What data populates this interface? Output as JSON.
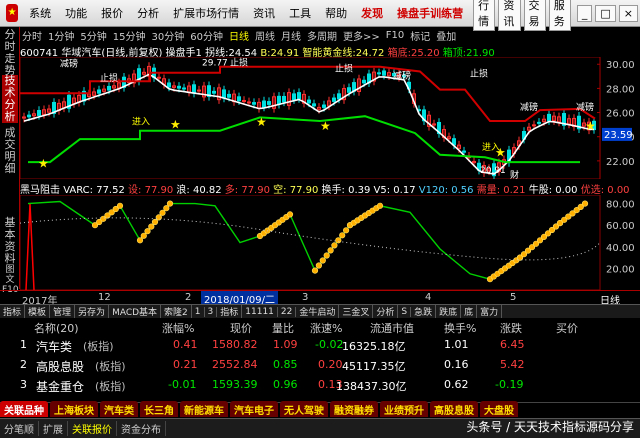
{
  "menu": {
    "app": "系统",
    "items": [
      "功能",
      "报价",
      "分析",
      "扩展市场行情",
      "资讯",
      "工具",
      "帮助"
    ],
    "highlight": "发现",
    "promo": "操盘手训练营",
    "right_btns": [
      "行情",
      "资讯",
      "交易",
      "服务"
    ]
  },
  "left_tabs": [
    "分时走势",
    "技术分析",
    "成交明细",
    "基本资料",
    "图文F10"
  ],
  "periods": [
    "分时",
    "1分钟",
    "5分钟",
    "15分钟",
    "30分钟",
    "60分钟",
    "日线",
    "周线",
    "月线",
    "多周期",
    "更多>>",
    "F10",
    "标记",
    "叠加"
  ],
  "active_period": "日线",
  "info": {
    "code": "600741",
    "name": "华域汽车(日线,前复权)",
    "f1_label": "操盘手1",
    "f1": "拐线:",
    "f1v": "24.54",
    "b_label": "B:",
    "b_val": "24.91",
    "zn_label": "智能黄金线:",
    "zn_val": "24.72",
    "box_hi": "箱底:",
    "box_hi_v": "25.20",
    "box_lo": "箱顶:",
    "box_lo_v": "21.90"
  },
  "price_axis": [
    "30.00",
    "28.00",
    "26.00",
    "24.00",
    "22.00"
  ],
  "price_tag": "23.59",
  "annot": {
    "stop1": "止损",
    "stop2": "止损",
    "stop3": "止损",
    "stop4": "止损",
    "jian1": "减磅",
    "jian2": "减磅",
    "jian3": "减磅",
    "jian4": "减磅",
    "jin1": "进入",
    "jin2": "进入",
    "hi": "29.77",
    "lo": "20.91",
    "cai": "财"
  },
  "ind": {
    "name": "黑马阻击",
    "varc": "VARC: 77.52",
    "a": "设: 77.90",
    "b": "浪: 40.82",
    "c": "多: 77.90",
    "d": "空: 77.90",
    "e": "换手: 0.39",
    "f": "V5: 0.17",
    "g": "V120: 0.56",
    "h": "需量: 0.21",
    "i": "牛股: 0.00",
    "j": "优选: 0.00"
  },
  "ind_axis": [
    "80.00",
    "60.00",
    "40.00",
    "20.00"
  ],
  "time_axis": [
    "2017年",
    "12",
    "2",
    "3",
    "4",
    "5"
  ],
  "time_sel": "2018/01/09/二",
  "timebar_right": "日线",
  "tools": [
    "指标",
    "模板",
    "管理",
    "另存为",
    "MACD基本",
    "索隆2",
    "1",
    "3",
    "指标",
    "11111",
    "22",
    "金牛启动",
    "三金叉",
    "分析",
    "S",
    "急跌",
    "跌底",
    "底",
    "富力"
  ],
  "table": {
    "headers": [
      "名称(20)",
      "涨幅%",
      "现价",
      "量比",
      "涨速%",
      "流通市值",
      "换手%",
      "涨跌",
      "买价"
    ],
    "rows": [
      {
        "idx": "1",
        "name": "汽车类",
        "tag": "(板指)",
        "chg": "0.41",
        "price": "1580.82",
        "vr": "1.09",
        "spd": "-0.02",
        "cap": "16325.18亿",
        "to": "1.01",
        "diff": "6.45",
        "bid": ""
      },
      {
        "idx": "2",
        "name": "高股息股",
        "tag": "(板指)",
        "chg": "0.21",
        "price": "2552.84",
        "vr": "0.85",
        "spd": "0.20",
        "cap": "45117.35亿",
        "to": "0.16",
        "diff": "5.42",
        "bid": ""
      },
      {
        "idx": "3",
        "name": "基金重仓",
        "tag": "(板指)",
        "chg": "-0.01",
        "price": "1593.39",
        "vr": "0.96",
        "spd": "0.13",
        "cap": "138437.30亿",
        "to": "0.62",
        "diff": "-0.19",
        "bid": ""
      }
    ]
  },
  "sectors": [
    "关联品种",
    "上海板块",
    "汽车类",
    "长三角",
    "新能源车",
    "汽车电子",
    "无人驾驶",
    "融资融券",
    "业绩预升",
    "高股息股",
    "大盘股"
  ],
  "bottom": [
    "分笔顺",
    "扩展",
    "关联报价",
    "资金分布"
  ],
  "watermark": "头条号 / 天天技术指标源码分享",
  "colors": {
    "up": "#ff3030",
    "down": "#00e0e0",
    "stop": "#d00000",
    "support": "#00dd00",
    "ma": "#ffffff",
    "star": "#ffee00"
  }
}
